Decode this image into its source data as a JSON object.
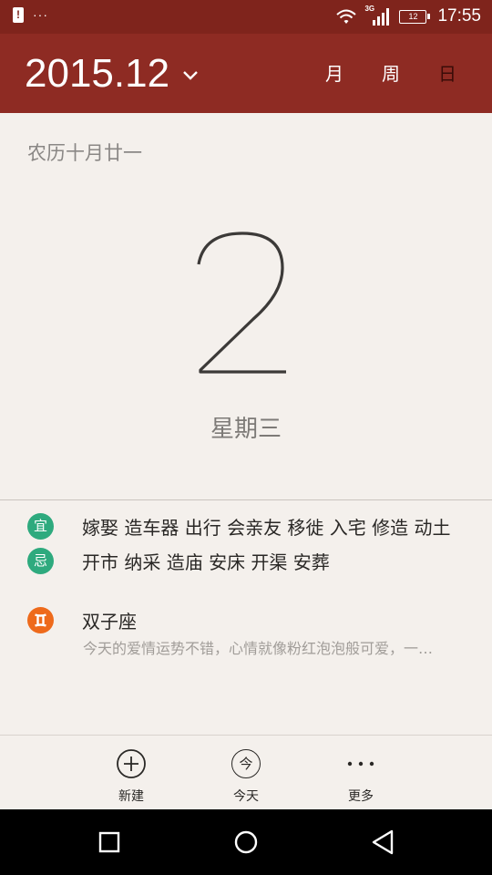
{
  "status_bar": {
    "network": "3G",
    "battery": "12",
    "time": "17:55",
    "icons": [
      "alert-icon",
      "more-dots-icon",
      "wifi-icon",
      "signal-icon",
      "battery-icon"
    ]
  },
  "header": {
    "month_label": "2015.12",
    "tabs": [
      {
        "label": "月",
        "active": false
      },
      {
        "label": "周",
        "active": false
      },
      {
        "label": "日",
        "active": true
      }
    ],
    "color": "#8e2b23"
  },
  "day": {
    "lunar": "农历十月廿一",
    "day_number": "2",
    "weekday": "星期三"
  },
  "almanac": {
    "good": {
      "badge": "宜",
      "text": "嫁娶 造车器 出行 会亲友 移徙 入宅 修造 动土"
    },
    "bad": {
      "badge": "忌",
      "text": "开市 纳采 造庙 安床 开渠 安葬"
    },
    "badge_color": "#2eaa7e"
  },
  "horoscope": {
    "icon": "gemini-icon",
    "title": "双子座",
    "description": "今天的爱情运势不错，心情就像粉红泡泡般可爱，一整天都很开心",
    "color": "#ee6a1b"
  },
  "toolbar": {
    "new_label": "新建",
    "today_label": "今天",
    "today_icon_char": "今",
    "more_label": "更多"
  }
}
